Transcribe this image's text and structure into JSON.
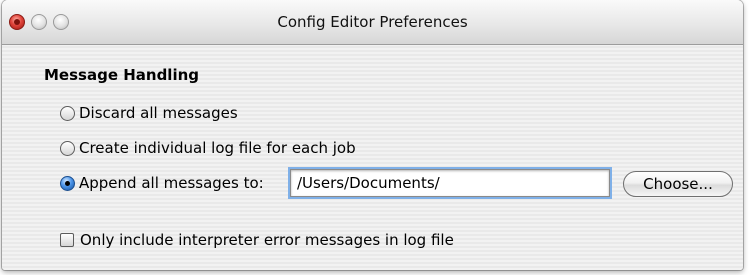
{
  "window": {
    "title": "Config Editor Preferences"
  },
  "message_handling": {
    "section_title": "Message Handling",
    "options": [
      {
        "label": "Discard all messages",
        "selected": false
      },
      {
        "label": "Create individual log file for each job",
        "selected": false
      },
      {
        "label": "Append all messages to:",
        "selected": true
      }
    ],
    "path_value": "/Users/Documents/",
    "choose_label": "Choose...",
    "only_errors_label": "Only include interpreter error messages in log file",
    "only_errors_checked": false
  },
  "colors": {
    "accent_blue": "#4c95e9",
    "close_red": "#e0443b"
  }
}
